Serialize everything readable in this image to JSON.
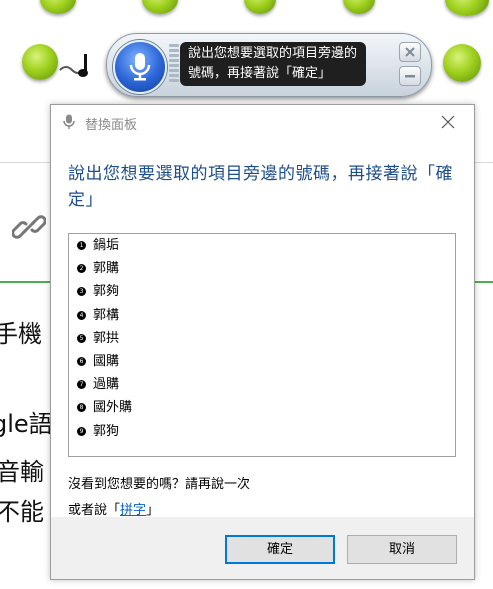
{
  "background": {
    "text_lines": [
      "手機",
      "gle語",
      "音輸",
      "不能"
    ]
  },
  "speech_bar": {
    "mic_icon": "microphone-icon",
    "message": "說出您想要選取的項目旁邊的號碼，再接著說「確定」"
  },
  "dialog": {
    "title": "替換面板",
    "title_icon": "microphone-icon",
    "instruction": "說出您想要選取的項目旁邊的號碼，再接著說「確定」",
    "options": [
      {
        "num": "1",
        "label": "鍋垢"
      },
      {
        "num": "2",
        "label": "郭購"
      },
      {
        "num": "3",
        "label": "郭夠"
      },
      {
        "num": "4",
        "label": "郭構"
      },
      {
        "num": "5",
        "label": "郭拱"
      },
      {
        "num": "6",
        "label": "國購"
      },
      {
        "num": "7",
        "label": "過購"
      },
      {
        "num": "8",
        "label": "國外購"
      },
      {
        "num": "9",
        "label": "郭狗"
      }
    ],
    "not_found_text": "沒看到您想要的嗎？請再說一次",
    "or_say_prefix": "或者說「",
    "or_say_link": "拼字",
    "or_say_suffix": "」",
    "ok_label": "確定",
    "cancel_label": "取消"
  }
}
